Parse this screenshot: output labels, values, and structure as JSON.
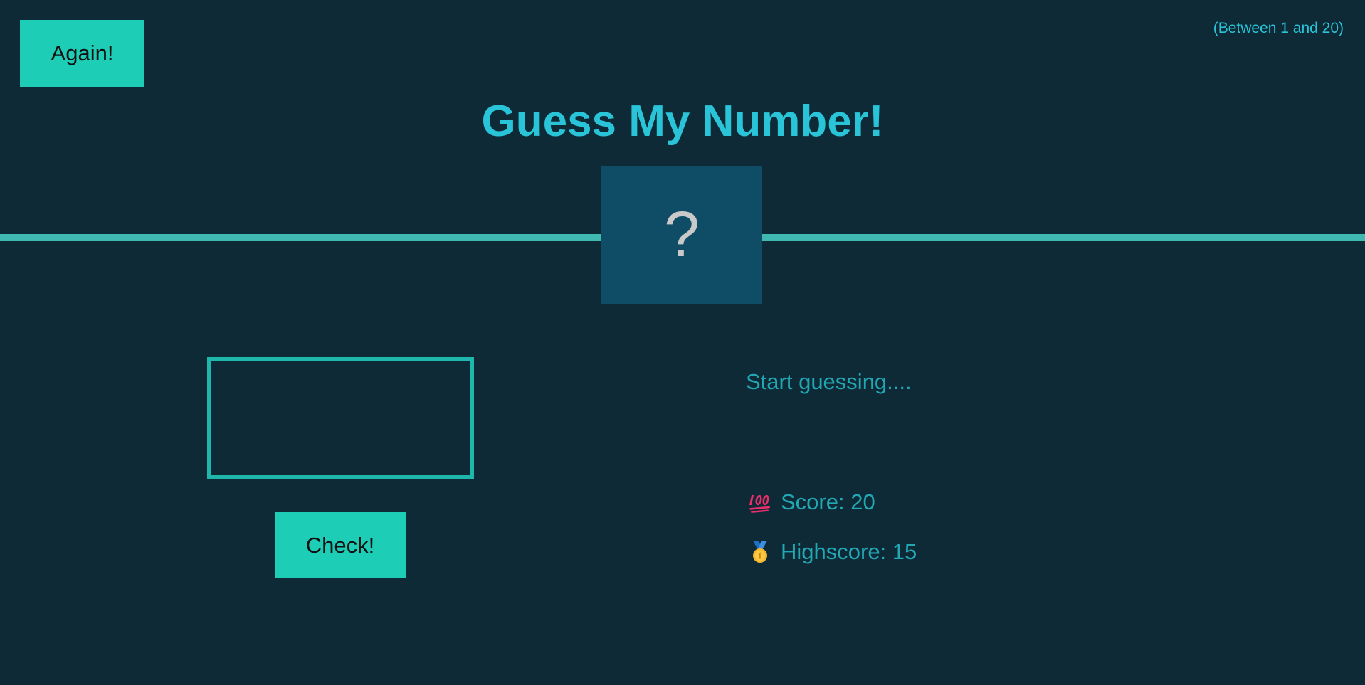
{
  "header": {
    "again_label": "Again!",
    "range_hint": "(Between 1 and 20)",
    "title": "Guess My Number!"
  },
  "secret": {
    "display": "?"
  },
  "guess": {
    "value": "",
    "placeholder": ""
  },
  "actions": {
    "check_label": "Check!"
  },
  "status": {
    "message": "Start guessing....",
    "score_label": "Score: 20",
    "highscore_label": "Highscore: 15",
    "score_icon": "hundred-points-icon",
    "highscore_icon": "medal-icon"
  },
  "colors": {
    "background": "#0e2a36",
    "accent": "#1ecdb6",
    "title": "#29c4d8",
    "number_box": "#0f4d66",
    "divider": "#3fb9b2",
    "stat_text": "#22a7b4"
  }
}
